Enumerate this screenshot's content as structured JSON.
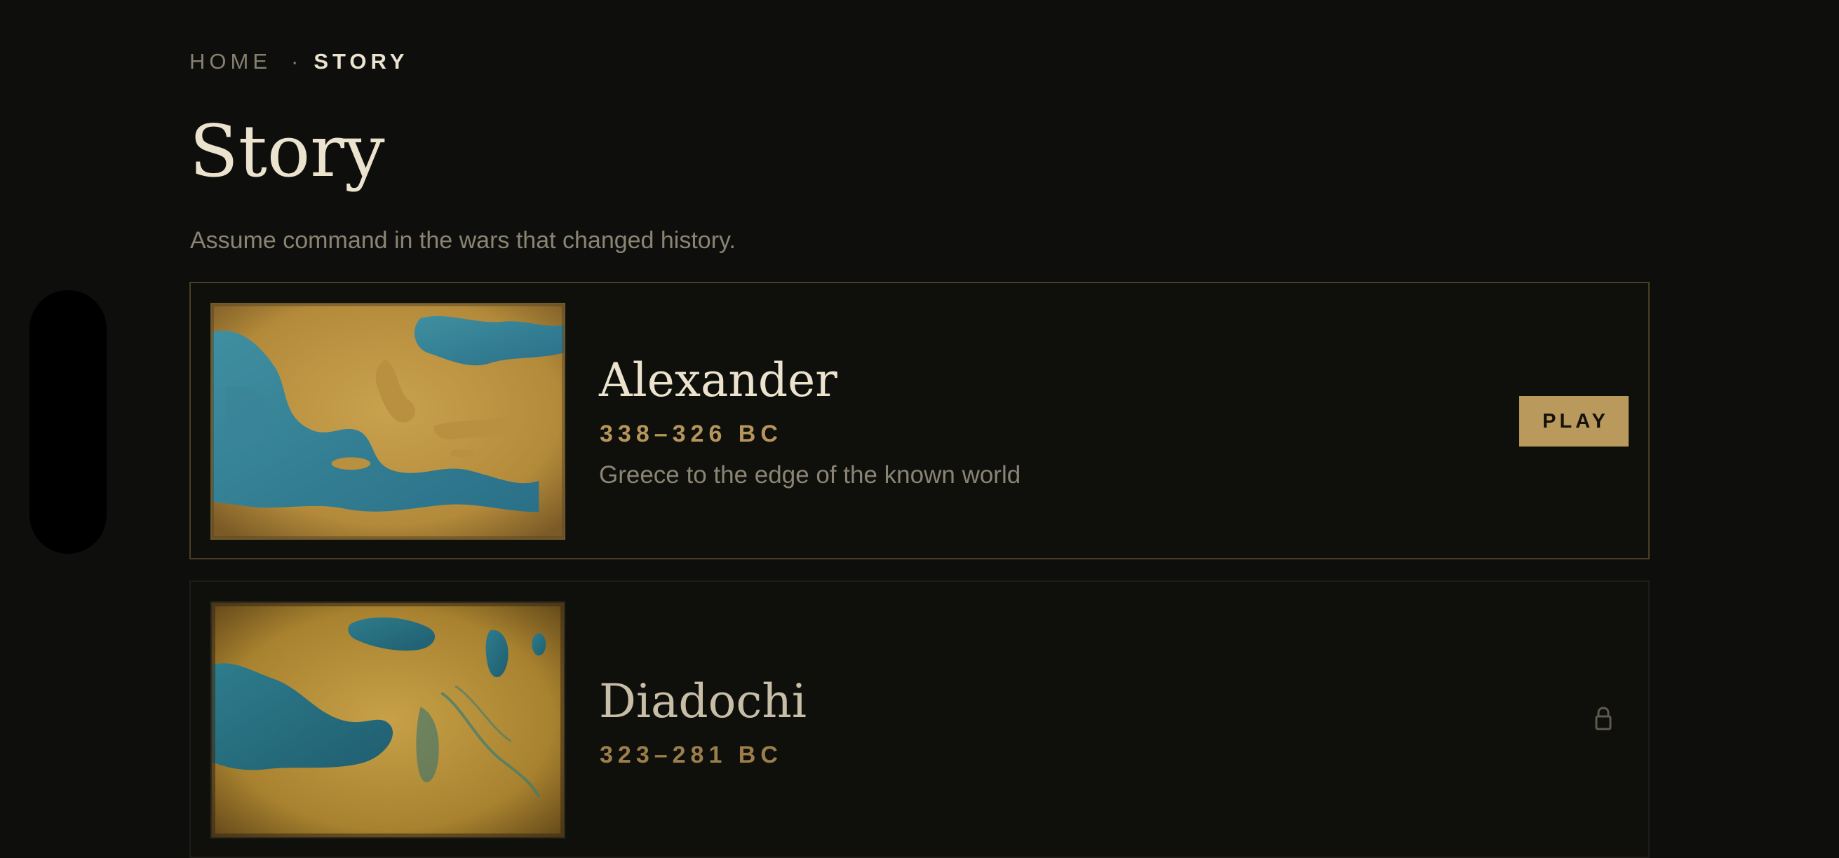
{
  "breadcrumb": {
    "home": "HOME",
    "separator": "·",
    "current": "STORY"
  },
  "page": {
    "title": "Story",
    "subtitle": "Assume command in the wars that changed history."
  },
  "campaigns": [
    {
      "title": "Alexander",
      "dates": "338–326 BC",
      "description": "Greece to the edge of the known world",
      "action": "PLAY",
      "locked": false,
      "thumbnail": "map-eastern-mediterranean"
    },
    {
      "title": "Diadochi",
      "dates": "323–281 BC",
      "locked": true,
      "icon": "lock-icon",
      "thumbnail": "map-mediterranean-near-east"
    }
  ],
  "colors": {
    "background": "#0e0e0c",
    "accent_gold": "#b99a5c",
    "date_gold": "#b6955a",
    "text_primary": "#ece3cf",
    "text_muted": "#8a8473",
    "active_border": "#4a3f26"
  }
}
